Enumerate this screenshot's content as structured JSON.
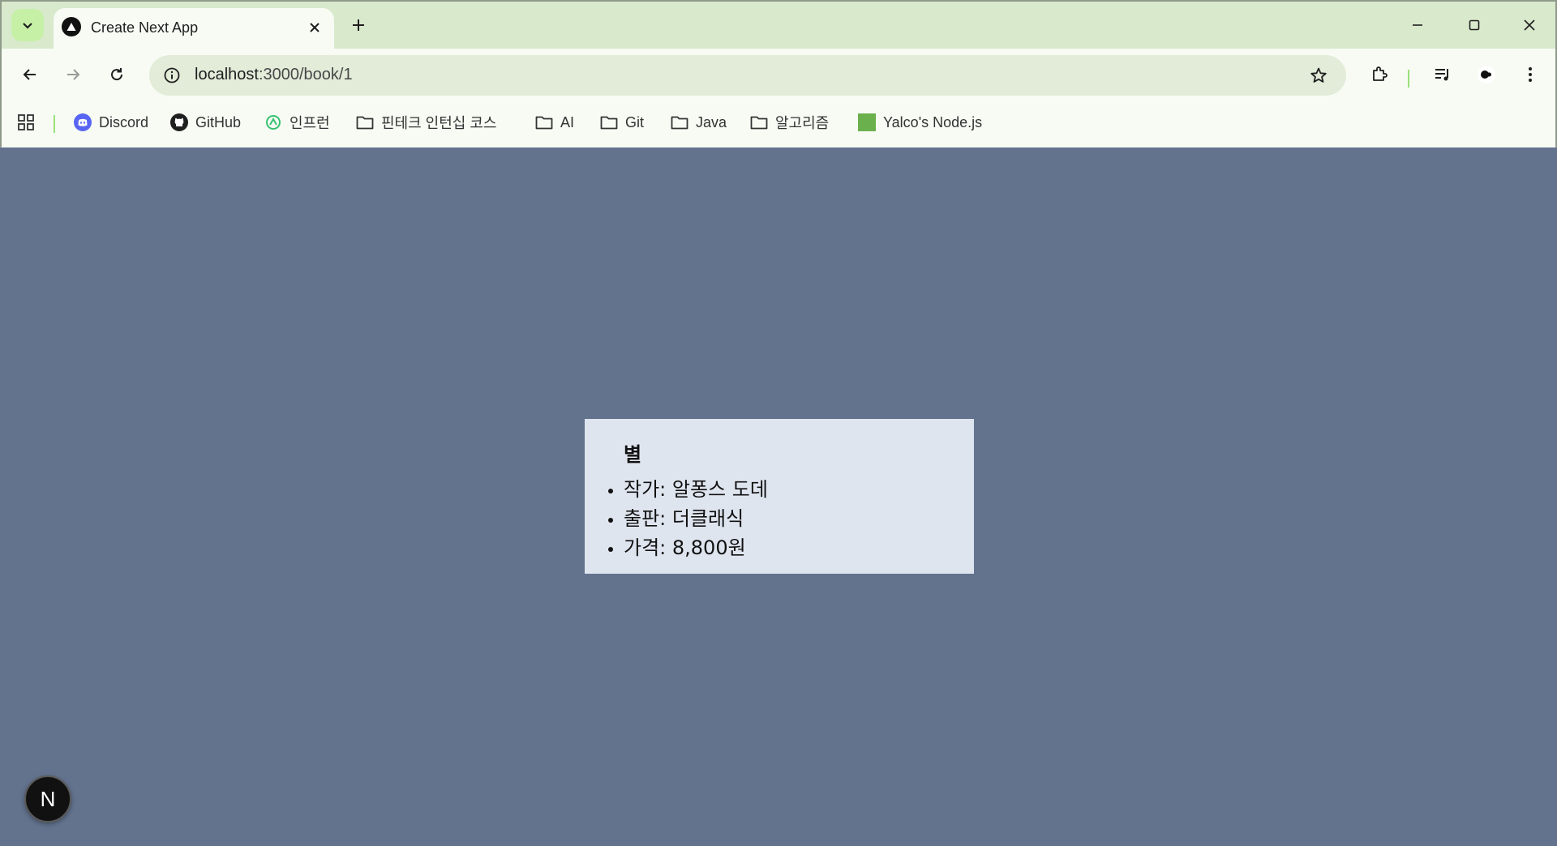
{
  "browser": {
    "tab": {
      "title": "Create Next App",
      "favicon": "nextjs-triangle-icon"
    },
    "address": {
      "host": "localhost",
      "path": ":3000/book/1"
    },
    "bookmarks": [
      {
        "label": "Discord",
        "icon": "discord-icon"
      },
      {
        "label": "GitHub",
        "icon": "github-icon"
      },
      {
        "label": "인프런",
        "icon": "inflearn-icon"
      },
      {
        "label": "핀테크 인턴십 코스",
        "icon": "folder-icon"
      },
      {
        "label": "AI",
        "icon": "folder-icon"
      },
      {
        "label": "Git",
        "icon": "folder-icon"
      },
      {
        "label": "Java",
        "icon": "folder-icon"
      },
      {
        "label": "알고리즘",
        "icon": "folder-icon"
      },
      {
        "label": "Yalco's Node.js",
        "icon": "green-square-icon"
      }
    ],
    "colors": {
      "frame": "#d8e9cc",
      "toolbar": "#f7fbf3",
      "omnibox": "#e2ecd9",
      "accent": "#9be07a"
    }
  },
  "page": {
    "background": "#63738e",
    "book": {
      "title": "별",
      "rows": [
        {
          "label": "작가: ",
          "value": "알퐁스 도데"
        },
        {
          "label": "출판: ",
          "value": "더클래식"
        },
        {
          "label": "가격: ",
          "value": "8,800원"
        }
      ]
    },
    "next_badge": "N"
  }
}
